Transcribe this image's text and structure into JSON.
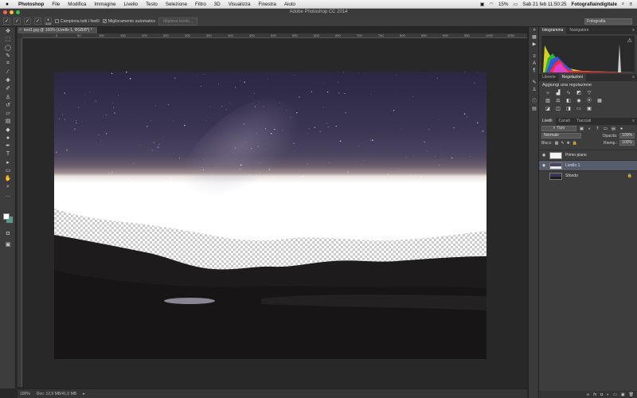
{
  "menubar": {
    "apple": "",
    "items": [
      "Photoshop",
      "File",
      "Modifica",
      "Immagine",
      "Livello",
      "Testo",
      "Selezione",
      "Filtro",
      "3D",
      "Visualizza",
      "Finestra",
      "Aiuto"
    ],
    "battery": "15%",
    "datetime": "Sab 21 feb  11:50:25",
    "user": "Fotografiaindigitale"
  },
  "window": {
    "title": "Adobe Photoshop CC 2014"
  },
  "options": {
    "brush_size": "100",
    "sample_all": "Campiona tutti i livelli",
    "auto_enhance": "Miglioramento automatico",
    "refine_edge": "Migliora bordo...",
    "workspace": "Fotografia"
  },
  "document": {
    "tab_title": "test1.jpg @ 100% (Livello 1, RGB/8*) *",
    "close": "×",
    "ruler_ticks": [
      "0",
      "50",
      "100",
      "150",
      "200",
      "250",
      "300",
      "350",
      "400",
      "450",
      "500",
      "550",
      "600",
      "650",
      "700",
      "750",
      "800",
      "850",
      "900",
      "950",
      "1000",
      "1050"
    ]
  },
  "status": {
    "zoom": "100%",
    "doc": "Doc: 12,9 MB/41,0 MB",
    "arrow": "▸"
  },
  "panels": {
    "histogram_tab": "Istogramma",
    "navigator_tab": "Navigatore",
    "warning": "⚠",
    "libraries_tab": "Librerie",
    "adjustments_tab": "Regolazioni",
    "add_adjustment": "Aggiungi una regolazione",
    "layers_tab": "Livelli",
    "channels_tab": "Canali",
    "paths_tab": "Tracciati",
    "kind_filter": "Tipo",
    "blend_mode": "Normale",
    "opacity_label": "Opacità:",
    "opacity_value": "100%",
    "lock_label": "Blocc:",
    "fill_label": "Riemp.:",
    "fill_value": "100%",
    "layers": [
      {
        "name": "Primo piano",
        "selected": false,
        "lock": ""
      },
      {
        "name": "Livello 1",
        "selected": true,
        "lock": ""
      },
      {
        "name": "Sfondo",
        "selected": false,
        "lock": "🔒"
      }
    ]
  }
}
